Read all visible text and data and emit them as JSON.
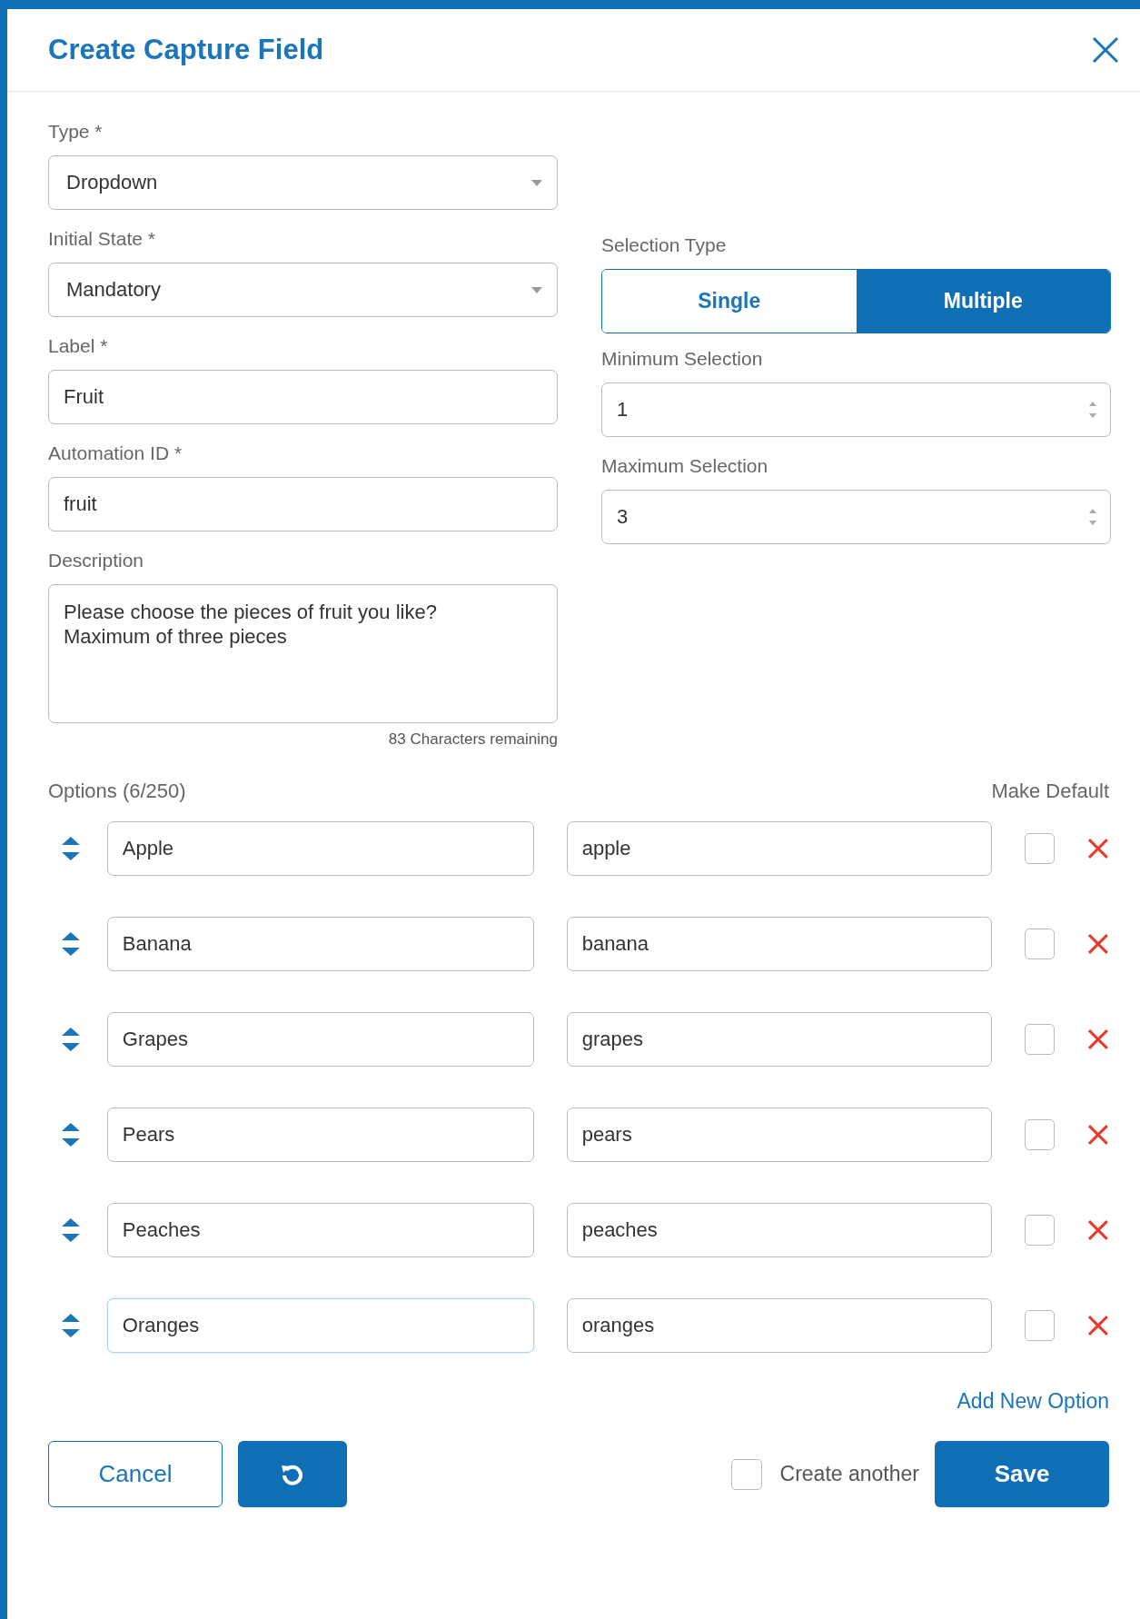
{
  "dialog": {
    "title": "Create Capture Field"
  },
  "type": {
    "label": "Type *",
    "value": "Dropdown"
  },
  "initial_state": {
    "label": "Initial State *",
    "value": "Mandatory"
  },
  "selection_type": {
    "label": "Selection Type",
    "options": [
      {
        "label": "Single",
        "selected": false
      },
      {
        "label": "Multiple",
        "selected": true
      }
    ]
  },
  "label_field": {
    "label": "Label *",
    "value": "Fruit"
  },
  "minimum_selection": {
    "label": "Minimum Selection",
    "value": "1"
  },
  "automation_id": {
    "label": "Automation ID *",
    "value": "fruit"
  },
  "maximum_selection": {
    "label": "Maximum Selection",
    "value": "3"
  },
  "description": {
    "label": "Description",
    "value": "Please choose the pieces of fruit you like?\nMaximum of three pieces",
    "counter": "83 Characters remaining"
  },
  "options": {
    "label": "Options (6/250)",
    "default_header": "Make Default",
    "add_link": "Add New Option",
    "items": [
      {
        "label": "Apple",
        "value": "apple",
        "default": false,
        "focused": false
      },
      {
        "label": "Banana",
        "value": "banana",
        "default": false,
        "focused": false
      },
      {
        "label": "Grapes",
        "value": "grapes",
        "default": false,
        "focused": false
      },
      {
        "label": "Pears",
        "value": "pears",
        "default": false,
        "focused": false
      },
      {
        "label": "Peaches",
        "value": "peaches",
        "default": false,
        "focused": false
      },
      {
        "label": "Oranges",
        "value": "oranges",
        "default": false,
        "focused": true
      }
    ]
  },
  "footer": {
    "cancel": "Cancel",
    "create_another": {
      "label": "Create another",
      "checked": false
    },
    "save": "Save"
  }
}
